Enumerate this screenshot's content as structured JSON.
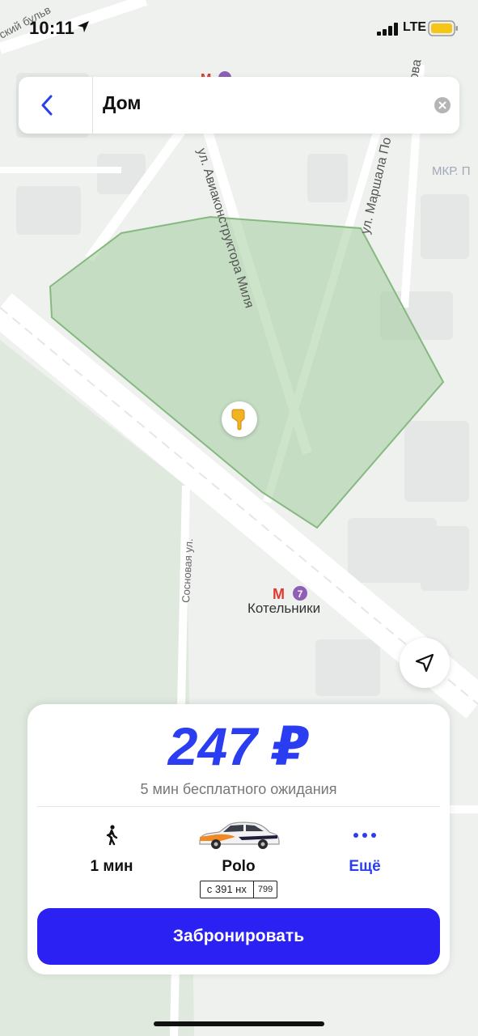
{
  "status_bar": {
    "time": "10:11",
    "network": "LTE",
    "battery_color": "#f5c518"
  },
  "search": {
    "query": "Дом"
  },
  "map": {
    "streets": {
      "aviakonstruktor": "ул. Авиаконструктора Миля",
      "marshala": "ул. Маршала По",
      "sosnovaya": "Сосновая ул.",
      "bulvar": "ский бульв",
      "partial_right": "ова",
      "mkr": "МКР. П"
    },
    "metro": {
      "name": "Котельники",
      "line": "7",
      "line_color": "#8e5fb5"
    },
    "zone_color": "#9bc997"
  },
  "card": {
    "price": "247 ₽",
    "waiting": "5 мин бесплатного ожидания",
    "walk": {
      "label": "1 мин",
      "icon": "walking-person-icon"
    },
    "car": {
      "model": "Polo",
      "plate_number": "с 391 нх",
      "plate_region": "799"
    },
    "more": {
      "label": "Ещё",
      "icon": "more-dots-icon"
    },
    "book_button": "Забронировать"
  },
  "colors": {
    "accent": "#2b3df0",
    "button": "#2b21f2"
  }
}
